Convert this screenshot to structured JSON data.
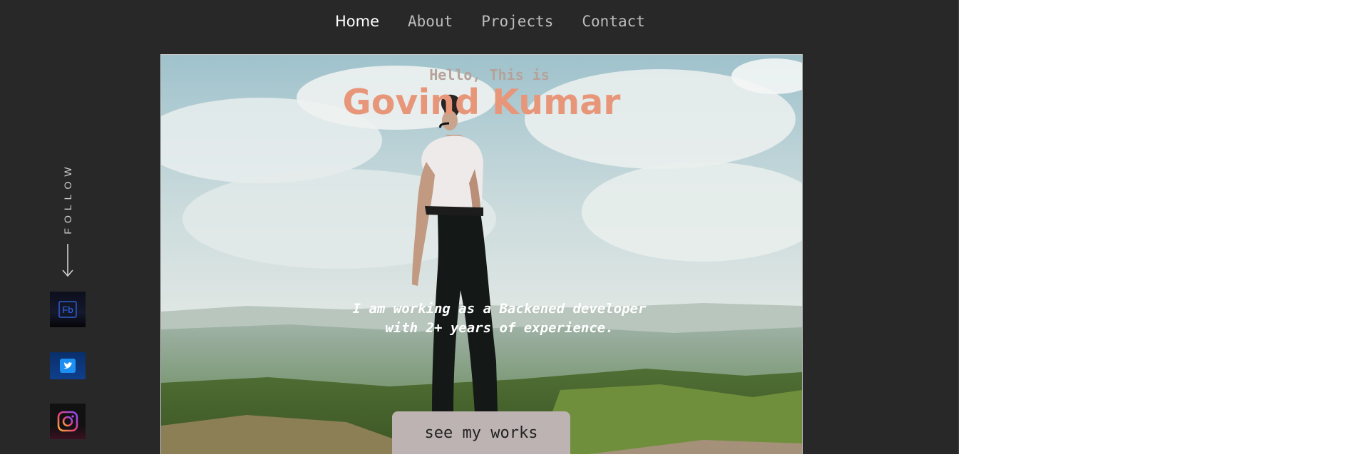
{
  "nav": {
    "items": [
      {
        "label": "Home",
        "active": true
      },
      {
        "label": "About",
        "active": false
      },
      {
        "label": "Projects",
        "active": false
      },
      {
        "label": "Contact",
        "active": false
      }
    ]
  },
  "sidebar": {
    "follow_label": "FOLLOW",
    "socials": [
      {
        "icon": "facebook-icon",
        "label": "Fb"
      },
      {
        "icon": "twitter-icon"
      },
      {
        "icon": "instagram-icon"
      }
    ]
  },
  "hero": {
    "greeting": "Hello, This is",
    "name": "Govind Kumar",
    "tagline_line1": "I am working as a Backened developer",
    "tagline_line2": "with 2+ years of experience.",
    "cta_label": "see my works"
  },
  "colors": {
    "page_bg": "#282828",
    "name_accent": "#e8967a",
    "cta_bg": "#bdb3b3"
  }
}
